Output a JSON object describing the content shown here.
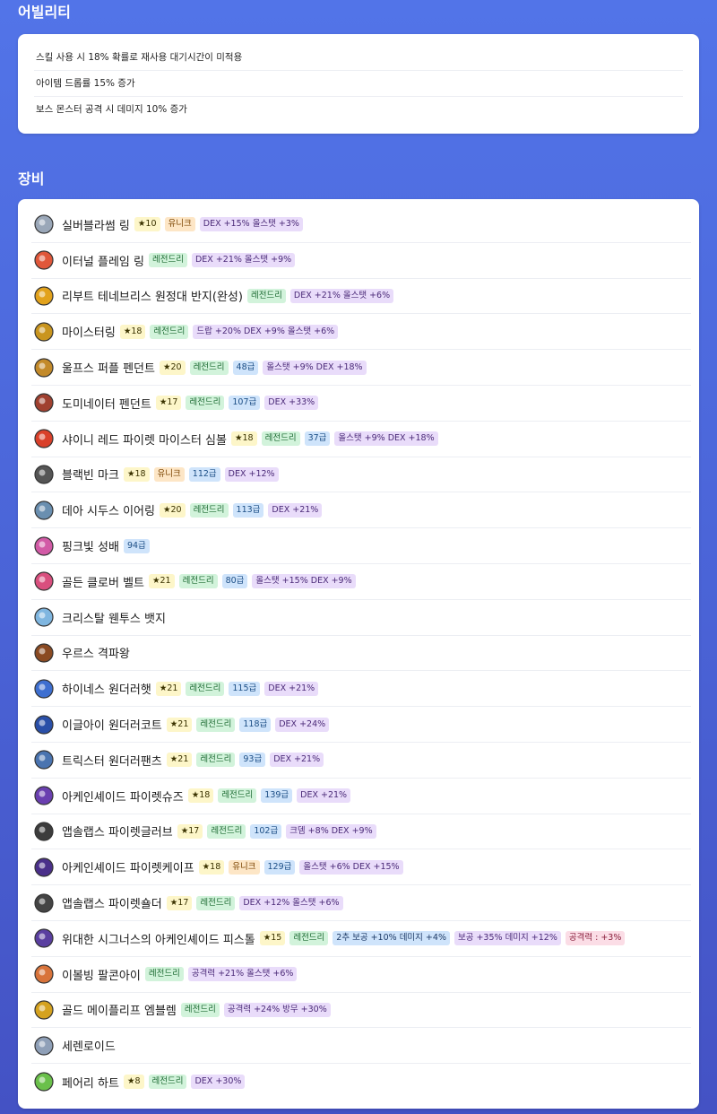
{
  "ability": {
    "title": "어빌리티",
    "lines": [
      "스킬 사용 시 18% 확률로 재사용 대기시간이 미적용",
      "아이템 드롭률 15% 증가",
      "보스 몬스터 공격 시 데미지 10% 증가"
    ]
  },
  "equipment": {
    "title": "장비",
    "items": [
      {
        "name": "실버블라썸 링",
        "icon": "silver-ring-icon",
        "color": "#9aa7b8",
        "tags": [
          {
            "type": "star",
            "text": "★10"
          },
          {
            "type": "unique",
            "text": "유니크"
          },
          {
            "type": "opt",
            "text": "DEX +15% 올스탯 +3%"
          }
        ]
      },
      {
        "name": "이터널 플레임 링",
        "icon": "flame-ring-icon",
        "color": "#e0573a",
        "tags": [
          {
            "type": "legend",
            "text": "레전드리"
          },
          {
            "type": "opt",
            "text": "DEX +21% 올스탯 +9%"
          }
        ]
      },
      {
        "name": "리부트 테네브리스 원정대 반지(완성)",
        "icon": "gold-ring-icon",
        "color": "#e2a21c",
        "tags": [
          {
            "type": "legend",
            "text": "레전드리"
          },
          {
            "type": "opt",
            "text": "DEX +21% 올스탯 +6%"
          }
        ]
      },
      {
        "name": "마이스터링",
        "icon": "meister-ring-icon",
        "color": "#c9951e",
        "tags": [
          {
            "type": "star",
            "text": "★18"
          },
          {
            "type": "legend",
            "text": "레전드리"
          },
          {
            "type": "opt",
            "text": "드랍 +20% DEX +9% 올스탯 +6%"
          }
        ]
      },
      {
        "name": "울프스 퍼플 펜던트",
        "icon": "pendant-icon",
        "color": "#c38a2a",
        "tags": [
          {
            "type": "star",
            "text": "★20"
          },
          {
            "type": "legend",
            "text": "레전드리"
          },
          {
            "type": "level",
            "text": "48급"
          },
          {
            "type": "opt",
            "text": "올스탯 +9% DEX +18%"
          }
        ]
      },
      {
        "name": "도미네이터 펜던트",
        "icon": "dominator-pendant-icon",
        "color": "#a0402f",
        "tags": [
          {
            "type": "star",
            "text": "★17"
          },
          {
            "type": "legend",
            "text": "레전드리"
          },
          {
            "type": "level",
            "text": "107급"
          },
          {
            "type": "opt",
            "text": "DEX +33%"
          }
        ]
      },
      {
        "name": "샤이니 레드 파이렛 마이스터 심볼",
        "icon": "symbol-card-icon",
        "color": "#d9402a",
        "tags": [
          {
            "type": "star",
            "text": "★18"
          },
          {
            "type": "legend",
            "text": "레전드리"
          },
          {
            "type": "level",
            "text": "37급"
          },
          {
            "type": "opt",
            "text": "올스탯 +9% DEX +18%"
          }
        ]
      },
      {
        "name": "블랙빈 마크",
        "icon": "mark-card-icon",
        "color": "#555555",
        "tags": [
          {
            "type": "star",
            "text": "★18"
          },
          {
            "type": "unique",
            "text": "유니크"
          },
          {
            "type": "level",
            "text": "112급"
          },
          {
            "type": "opt",
            "text": "DEX +12%"
          }
        ]
      },
      {
        "name": "데아 시두스 이어링",
        "icon": "earring-icon",
        "color": "#6a8fb0",
        "tags": [
          {
            "type": "star",
            "text": "★20"
          },
          {
            "type": "legend",
            "text": "레전드리"
          },
          {
            "type": "level",
            "text": "113급"
          },
          {
            "type": "opt",
            "text": "DEX +21%"
          }
        ]
      },
      {
        "name": "핑크빛 성배",
        "icon": "pink-cup-icon",
        "color": "#d25aa6",
        "tags": [
          {
            "type": "level",
            "text": "94급"
          }
        ]
      },
      {
        "name": "골든 클로버 벨트",
        "icon": "belt-icon",
        "color": "#d94f7e",
        "tags": [
          {
            "type": "star",
            "text": "★21"
          },
          {
            "type": "legend",
            "text": "레전드리"
          },
          {
            "type": "level",
            "text": "80급"
          },
          {
            "type": "opt",
            "text": "올스탯 +15% DEX +9%"
          }
        ]
      },
      {
        "name": "크리스탈 웬투스 뱃지",
        "icon": "badge-icon",
        "color": "#7fb6e0",
        "tags": []
      },
      {
        "name": "우르스 격파왕",
        "icon": "medal-icon",
        "color": "#8a4a22",
        "tags": []
      },
      {
        "name": "하이네스 원더러햇",
        "icon": "hat-icon",
        "color": "#3e6fd0",
        "tags": [
          {
            "type": "star",
            "text": "★21"
          },
          {
            "type": "legend",
            "text": "레전드리"
          },
          {
            "type": "level",
            "text": "115급"
          },
          {
            "type": "opt",
            "text": "DEX +21%"
          }
        ]
      },
      {
        "name": "이글아이 원더러코트",
        "icon": "coat-icon",
        "color": "#2a4fa8",
        "tags": [
          {
            "type": "star",
            "text": "★21"
          },
          {
            "type": "legend",
            "text": "레전드리"
          },
          {
            "type": "level",
            "text": "118급"
          },
          {
            "type": "opt",
            "text": "DEX +24%"
          }
        ]
      },
      {
        "name": "트릭스터 원더러팬츠",
        "icon": "pants-icon",
        "color": "#4a74b0",
        "tags": [
          {
            "type": "star",
            "text": "★21"
          },
          {
            "type": "legend",
            "text": "레전드리"
          },
          {
            "type": "level",
            "text": "93급"
          },
          {
            "type": "opt",
            "text": "DEX +21%"
          }
        ]
      },
      {
        "name": "아케인셰이드 파이렛슈즈",
        "icon": "shoes-icon",
        "color": "#6a3fb0",
        "tags": [
          {
            "type": "star",
            "text": "★18"
          },
          {
            "type": "legend",
            "text": "레전드리"
          },
          {
            "type": "level",
            "text": "139급"
          },
          {
            "type": "opt",
            "text": "DEX +21%"
          }
        ]
      },
      {
        "name": "앱솔랩스 파이렛글러브",
        "icon": "glove-icon",
        "color": "#3c3c3c",
        "tags": [
          {
            "type": "star",
            "text": "★17"
          },
          {
            "type": "legend",
            "text": "레전드리"
          },
          {
            "type": "level",
            "text": "102급"
          },
          {
            "type": "opt",
            "text": "크뎀 +8% DEX +9%"
          }
        ]
      },
      {
        "name": "아케인셰이드 파이렛케이프",
        "icon": "cape-icon",
        "color": "#4a2f8a",
        "tags": [
          {
            "type": "star",
            "text": "★18"
          },
          {
            "type": "unique",
            "text": "유니크"
          },
          {
            "type": "level",
            "text": "129급"
          },
          {
            "type": "opt",
            "text": "올스탯 +6% DEX +15%"
          }
        ]
      },
      {
        "name": "앱솔랩스 파이렛숄더",
        "icon": "shoulder-icon",
        "color": "#444444",
        "tags": [
          {
            "type": "star",
            "text": "★17"
          },
          {
            "type": "legend",
            "text": "레전드리"
          },
          {
            "type": "opt",
            "text": "DEX +12% 올스탯 +6%"
          }
        ]
      },
      {
        "name": "위대한 시그너스의 아케인셰이드 피스톨",
        "icon": "pistol-icon",
        "color": "#5a3fa0",
        "tags": [
          {
            "type": "star",
            "text": "★15"
          },
          {
            "type": "legend",
            "text": "레전드리"
          },
          {
            "type": "add",
            "text": "2추 보공 +10% 데미지 +4%"
          },
          {
            "type": "opt",
            "text": "보공 +35% 데미지 +12%"
          },
          {
            "type": "atk",
            "text": "공격력 : +3%"
          }
        ]
      },
      {
        "name": "이볼빙 팔콘아이",
        "icon": "eye-accessory-icon",
        "color": "#d8733a",
        "tags": [
          {
            "type": "legend",
            "text": "레전드리"
          },
          {
            "type": "opt",
            "text": "공격력 +21% 올스탯 +6%"
          }
        ]
      },
      {
        "name": "골드 메이플리프 엠블렘",
        "icon": "emblem-icon",
        "color": "#d5a21f",
        "tags": [
          {
            "type": "legend",
            "text": "레전드리"
          },
          {
            "type": "opt",
            "text": "공격력 +24% 방무 +30%"
          }
        ]
      },
      {
        "name": "세렌로이드",
        "icon": "android-icon",
        "color": "#8fa0b8",
        "tags": []
      },
      {
        "name": "페어리 하트",
        "icon": "fairy-heart-icon",
        "color": "#6ac04a",
        "tags": [
          {
            "type": "star",
            "text": "★8"
          },
          {
            "type": "legend",
            "text": "레전드리"
          },
          {
            "type": "opt",
            "text": "DEX +30%"
          }
        ]
      }
    ]
  }
}
